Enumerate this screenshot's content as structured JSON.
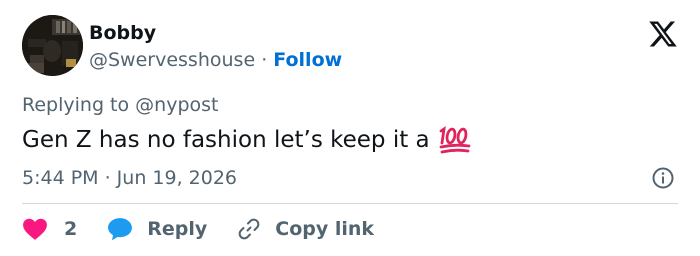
{
  "author": {
    "display_name": "Bobby",
    "handle": "@Swervesshouse",
    "separator": "·",
    "follow_label": "Follow",
    "avatar_icon": "avatar-photo"
  },
  "header": {
    "brand_icon": "x-logo-icon"
  },
  "tweet": {
    "replying_to": "Replying to @nypost",
    "text": "Gen Z has no fashion let’s keep it a",
    "emoji_icon": "hundred-points-emoji",
    "timestamp": "5:44 PM · Jun 19, 2026"
  },
  "actions": {
    "like_count": "2",
    "reply_label": "Reply",
    "copy_link_label": "Copy link"
  },
  "colors": {
    "follow_blue": "#006fd6",
    "like_red": "#f91880",
    "reply_blue": "#1d9bf0",
    "secondary_text": "#536471",
    "primary_text": "#0f1419",
    "divider": "#cfd9de"
  }
}
